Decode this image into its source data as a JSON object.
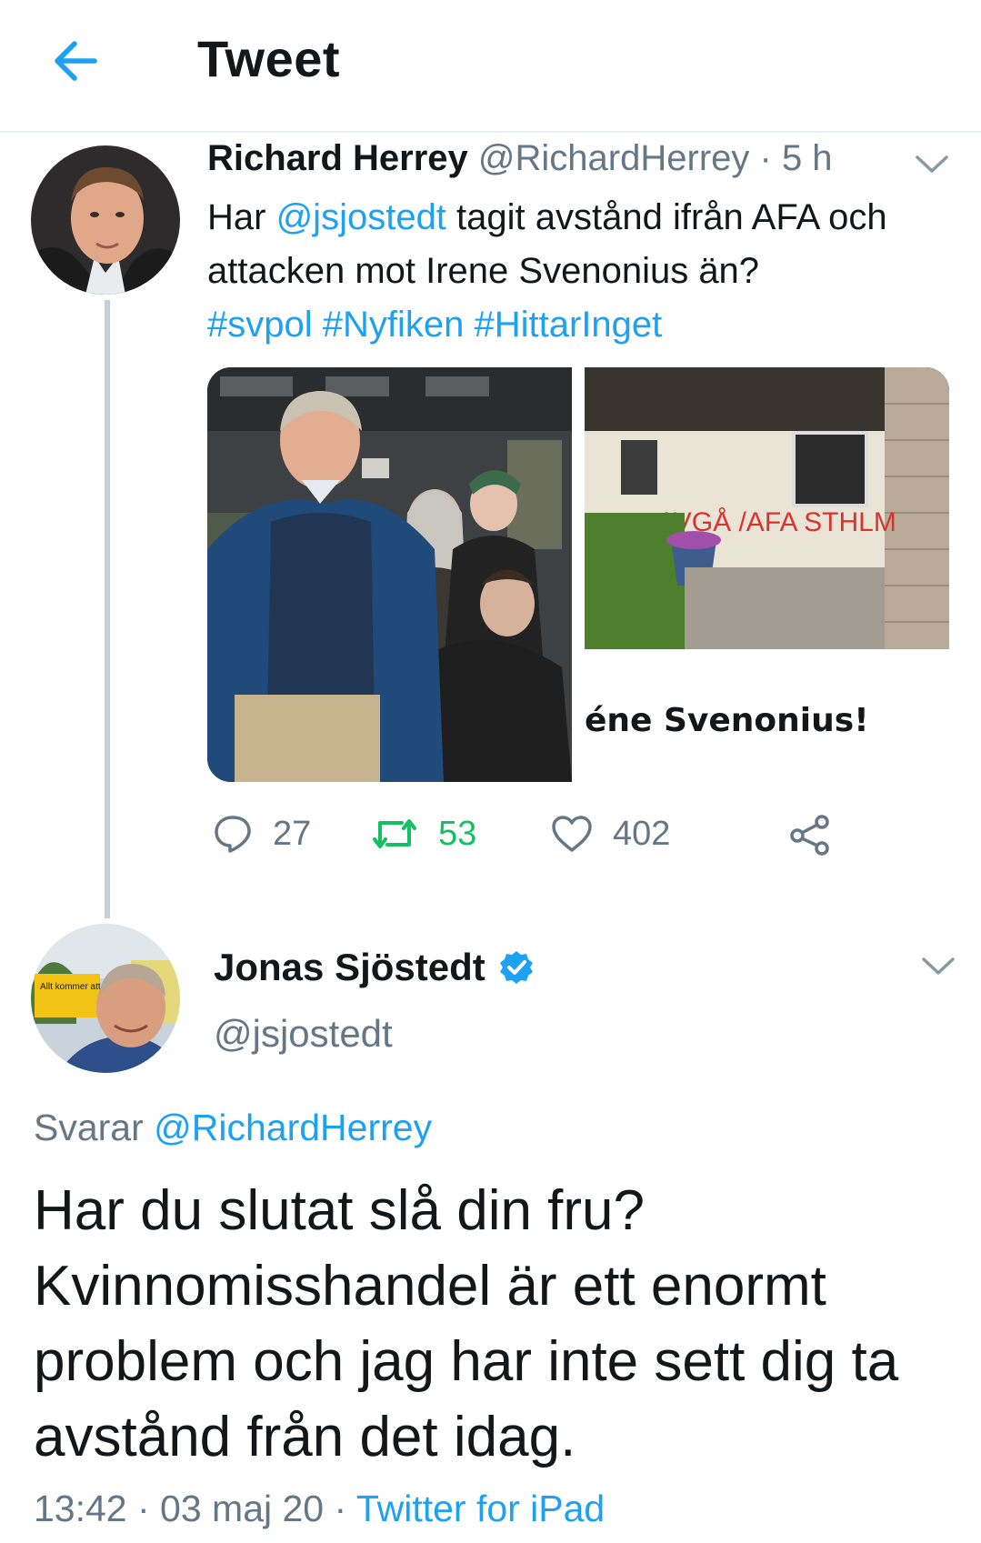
{
  "header": {
    "title": "Tweet"
  },
  "tweet1": {
    "display_name": "Richard Herrey",
    "handle": "@RichardHerrey",
    "separator": " · ",
    "time": "5 h",
    "text_part1": "Har ",
    "mention": "@jsjostedt",
    "text_part2": " tagit avstånd ifrån AFA och attacken mot Irene Svenonius än?",
    "hashtags": [
      "#svpol",
      "#Nyfiken",
      "#HittarInget"
    ],
    "card_caption": "éne Svenonius!",
    "graffiti": "AVGÅ /AFA STHLM",
    "counts": {
      "replies": "27",
      "retweets": "53",
      "likes": "402"
    }
  },
  "tweet2": {
    "display_name": "Jonas Sjöstedt",
    "handle": "@jsjostedt",
    "reply_prefix": "Svarar ",
    "reply_to": "@RichardHerrey",
    "body": "Har du slutat slå din fru? Kvinnomisshandel är ett enormt problem och jag har inte sett dig ta avstånd från det idag.",
    "time": "13:42",
    "dot": " · ",
    "date": "03 maj 20",
    "source": "Twitter for iPad",
    "sign_text": "Allt kommer att bli bra"
  },
  "colors": {
    "link": "#1da1f2",
    "muted": "#657786",
    "retweet_active": "#17bf63",
    "divider": "#e6ecf0"
  },
  "icons": [
    "back-arrow-icon",
    "chevron-down-icon",
    "reply-icon",
    "retweet-icon",
    "like-icon",
    "share-icon",
    "verified-badge-icon"
  ]
}
